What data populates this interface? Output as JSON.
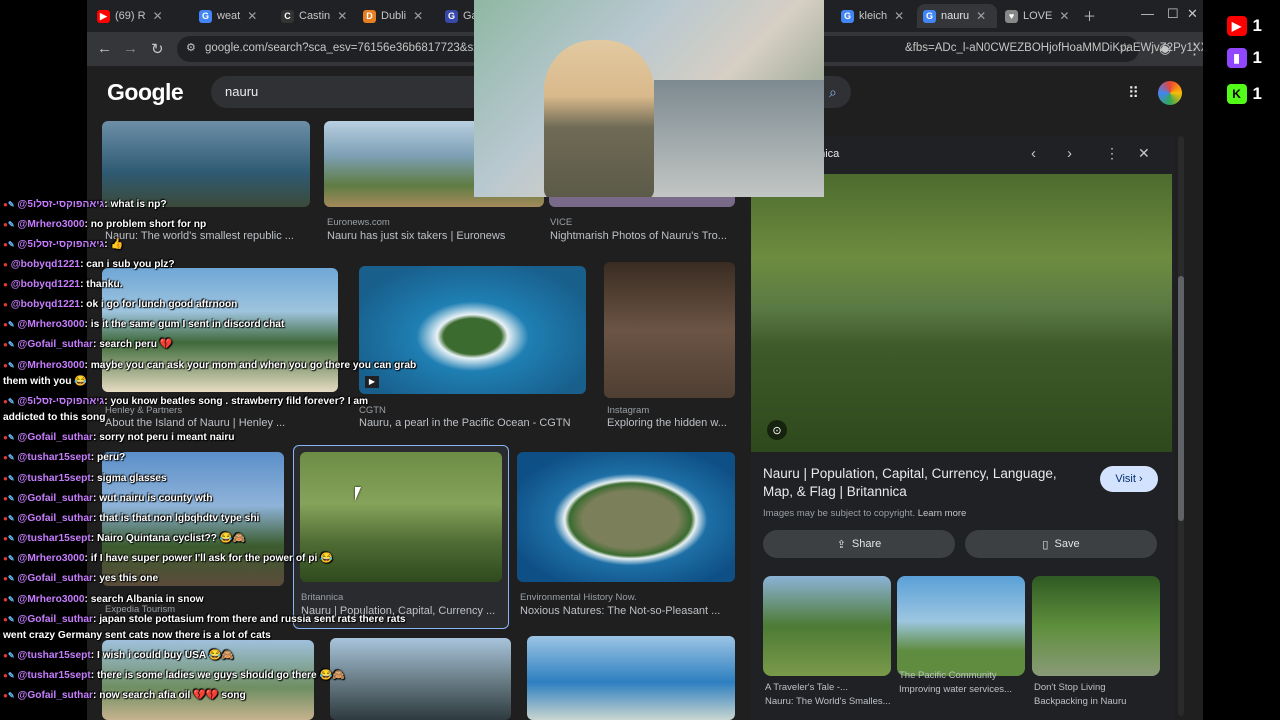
{
  "tabs": [
    {
      "label": "(69) R",
      "fav": "youtube-icon",
      "color": "#ff0000"
    },
    {
      "label": "weat",
      "fav": "google-icon",
      "color": "#4285f4"
    },
    {
      "label": "Castin",
      "fav": "castingwords-icon",
      "color": "#333333"
    },
    {
      "label": "Dubli",
      "fav": "dublin-icon",
      "color": "#e67e22"
    },
    {
      "label": "Ga",
      "fav": "ga-icon",
      "color": "#3949ab"
    },
    {
      "label": "kleich",
      "fav": "google-icon",
      "color": "#4285f4"
    },
    {
      "label": "nauru",
      "fav": "google-icon",
      "color": "#4285f4"
    },
    {
      "label": "LOVE",
      "fav": "love-icon",
      "color": "#888888"
    }
  ],
  "address": {
    "url": "google.com/search?sca_esv=76156e36b6817723&sxsrf=",
    "url_tail": "&fbs=ADc_l-aN0CWEZBOHjofHoaMMDiKpaEWjvZ2Py1XX..."
  },
  "search": {
    "logo": "Google",
    "query": "nauru"
  },
  "results": [
    {
      "source": "",
      "title": "Nauru: The world's smallest republic ..."
    },
    {
      "source": "Euronews.com",
      "title": "Nauru has just six takers | Euronews"
    },
    {
      "source": "VICE",
      "title": "Nightmarish Photos of Nauru's Tro..."
    },
    {
      "source": "Henley & Partners",
      "title": "About the Island of Nauru | Henley ..."
    },
    {
      "source": "CGTN",
      "title": "Nauru, a pearl in the Pacific Ocean - CGTN"
    },
    {
      "source": "Instagram",
      "title": "Exploring the hidden w..."
    },
    {
      "source": "Expedia Tourism",
      "title": ""
    },
    {
      "source": "Britannica",
      "title": "Nauru | Population, Capital, Currency ..."
    },
    {
      "source": "Environmental History Now.",
      "title": "Noxious Natures: The Not-so-Pleasant ..."
    }
  ],
  "panel": {
    "source": "nnica",
    "title": "Nauru | Population, Capital, Currency, Language, Map, & Flag | Britannica",
    "visit": "Visit",
    "copyright": "Images may be subject to copyright.",
    "learn_more": "Learn more",
    "share": "Share",
    "save": "Save",
    "related": [
      {
        "source": "A Traveler's Tale -...",
        "title": "Nauru: The World's Smalles..."
      },
      {
        "source": "The Pacific Community",
        "title": "Improving water services..."
      },
      {
        "source": "Don't Stop Living",
        "title": "Backpacking in Nauru"
      }
    ]
  },
  "chat": [
    {
      "name": "@גיאהפוקסי-זסלו5",
      "msg": ": what is np?",
      "badges": true
    },
    {
      "name": "@Mrhero3000",
      "msg": ": no problem short for np",
      "badges": true
    },
    {
      "name": "@גיאהפוקסי-זסלו5",
      "msg": ": 👍",
      "badges": true
    },
    {
      "name": "@bobyqd1221",
      "msg": ": can i sub you plz?",
      "badges": false
    },
    {
      "name": "@bobyqd1221",
      "msg": ": thanku.",
      "badges": false
    },
    {
      "name": "@bobyqd1221",
      "msg": ": ok i go for lunch good aftrnoon",
      "badges": false
    },
    {
      "name": "@Mrhero3000",
      "msg": ": is it the same gum I sent in discord chat",
      "badges": true
    },
    {
      "name": "@Gofail_suthar",
      "msg": ": search peru 💔",
      "badges": true
    },
    {
      "name": "@Mrhero3000",
      "msg": ": maybe you can ask your mom and when you go there you can grab",
      "badges": true
    },
    {
      "name": "",
      "msg": "them with you 😂",
      "badges": false
    },
    {
      "name": "@גיאהפוקסי-זסלו5",
      "msg": ": you know beatles song . strawberry fild forever? I am",
      "badges": true
    },
    {
      "name": "",
      "msg": "addicted to this song",
      "badges": false
    },
    {
      "name": "@Gofail_suthar",
      "msg": ": sorry not peru i meant nairu",
      "badges": true
    },
    {
      "name": "@tushar15sept",
      "msg": ": peru?",
      "badges": true
    },
    {
      "name": "@tushar15sept",
      "msg": ": sigma glasses",
      "badges": true
    },
    {
      "name": "@Gofail_suthar",
      "msg": ": wut nairu is county wth",
      "badges": true
    },
    {
      "name": "@Gofail_suthar",
      "msg": ": that is that non lgbqhdtv type shi",
      "badges": true
    },
    {
      "name": "@tushar15sept",
      "msg": ": Nairo Quintana cyclist?? 😂🙈",
      "badges": true
    },
    {
      "name": "@Mrhero3000",
      "msg": ": if I have super power I'll ask for the power of pi 😂",
      "badges": true
    },
    {
      "name": "@Gofail_suthar",
      "msg": ": yes this one",
      "badges": true
    },
    {
      "name": "@Mrhero3000",
      "msg": ": search Albania in snow",
      "badges": true
    },
    {
      "name": "@Gofail_suthar",
      "msg": ": japan stole pottasium from there and russia sent rats there rats",
      "badges": true
    },
    {
      "name": "",
      "msg": "went crazy Germany sent cats now there is a lot of cats",
      "badges": false
    },
    {
      "name": "@tushar15sept",
      "msg": ": I wish i could buy USA 😂🙈",
      "badges": true
    },
    {
      "name": "@tushar15sept",
      "msg": ": there is some ladies we guys should go there 😂🙈",
      "badges": true
    },
    {
      "name": "@Gofail_suthar",
      "msg": ": now search afia oil 💔💔 song",
      "badges": true
    }
  ],
  "counters": [
    {
      "platform": "youtube",
      "value": "1",
      "color": "#ff0000"
    },
    {
      "platform": "twitch",
      "value": "1",
      "color": "#9146ff"
    },
    {
      "platform": "kick",
      "value": "1",
      "color": "#53fc18"
    }
  ]
}
